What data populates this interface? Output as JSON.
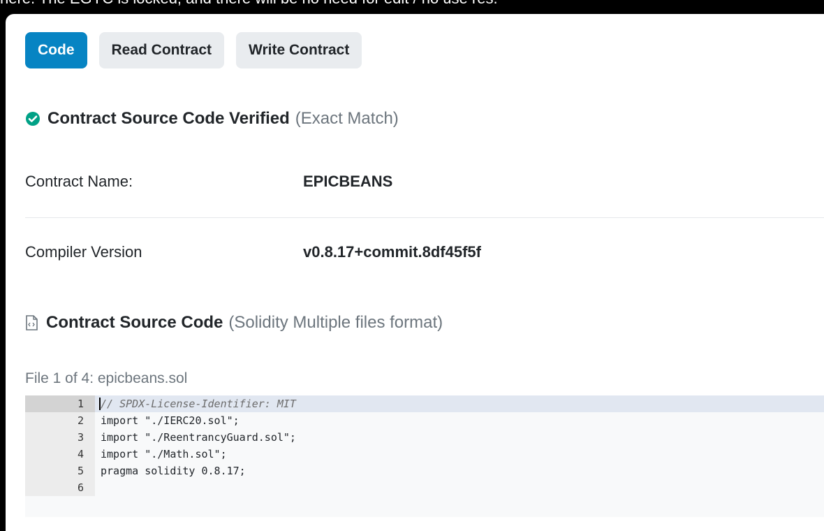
{
  "topstrip": {
    "text": "here. The EGYC is locked, and there will be no need for edit / no use res."
  },
  "tabs": [
    {
      "label": "Code",
      "active": true
    },
    {
      "label": "Read Contract",
      "active": false
    },
    {
      "label": "Write Contract",
      "active": false
    }
  ],
  "verified": {
    "title": "Contract Source Code Verified",
    "note": "(Exact Match)",
    "icon": "check-circle-icon"
  },
  "contract": {
    "name_label": "Contract Name:",
    "name_value": "EPICBEANS",
    "compiler_label": "Compiler Version",
    "compiler_value": "v0.8.17+commit.8df45f5f"
  },
  "source": {
    "title": "Contract Source Code",
    "note": "(Solidity Multiple files format)",
    "icon": "file-code-icon",
    "file_line": "File 1 of 4: epicbeans.sol"
  },
  "code": {
    "lines": [
      {
        "num": "1",
        "text": "// SPDX-License-Identifier: MIT",
        "comment": true
      },
      {
        "num": "2",
        "text": "import \"./IERC20.sol\";"
      },
      {
        "num": "3",
        "text": "import \"./ReentrancyGuard.sol\";"
      },
      {
        "num": "4",
        "text": "import \"./Math.sol\";"
      },
      {
        "num": "5",
        "text": "pragma solidity 0.8.17;"
      },
      {
        "num": "6",
        "text": ""
      }
    ]
  },
  "colors": {
    "accent": "#0784c3",
    "success": "#00a186"
  }
}
